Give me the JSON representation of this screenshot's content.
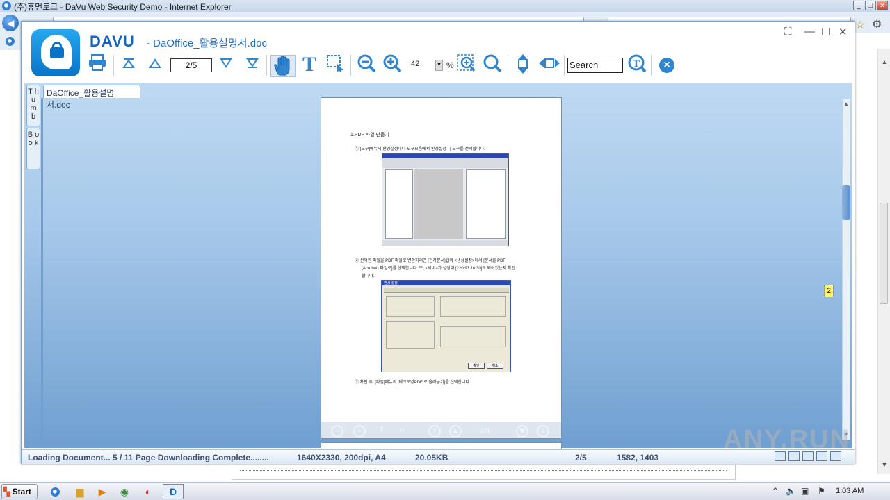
{
  "ie": {
    "title": "(주)휴먼토크 - DaVu Web Security Demo - Internet Explorer",
    "win_min": "_",
    "win_restore": "❐",
    "win_close": "✕"
  },
  "viewer": {
    "brand": "DAVU",
    "doc_title": "- DaOffice_활용설명서.doc",
    "page_input": "2/5",
    "zoom_value": "42",
    "zoom_unit": "%",
    "search_placeholder": "Search",
    "window_controls": [
      "⛶",
      "—",
      "☐",
      "✕"
    ],
    "tab_doc": "DaOffice_활용설명서.doc",
    "side_tabs": [
      "T h u m b",
      "B o o k"
    ],
    "page_badge": "2",
    "icons": [
      "print-icon",
      "first-page-icon",
      "prev-page-icon",
      "next-page-icon",
      "last-page-icon",
      "hand-tool-icon",
      "text-tool-icon",
      "select-tool-icon",
      "zoom-out-icon",
      "zoom-in-icon",
      "zoom-fit-icon",
      "search-zoom-icon",
      "fit-height-icon",
      "fit-width-icon",
      "search-text-icon",
      "close-icon"
    ],
    "page_toolbar_page": "2/5"
  },
  "document": {
    "heading": "1.PDF 파일 만들기",
    "step1": "① [도구]메뉴의 환경설정이나 도구모음에서 환경설정 [  ] 도구를 선택합니다.",
    "step2a": "② 선택한 파일을 PDF 파일로 변환하려면 [전자문서]탭의 <생성설정>에서 [문서를 PDF",
    "step2b": "(Acrobat) 파일로]를 선택합니다. 또, <서버>가 설정이 [220.93.10.30]로 되어있는지 확인",
    "step2c": "합니다.",
    "step3": "③ 확인 후, [파일]메뉴의 [메크로병PDF]로 올려놓기]를 선택합니다.",
    "dialog_title": "환경 설정",
    "dialog_ok": "확인",
    "dialog_cancel": "취소"
  },
  "status": {
    "loading": "Loading Document... 5 / 11 Page Downloading Complete........",
    "resolution": "1640X2330, 200dpi, A4",
    "size": "20.05KB",
    "page": "2/5",
    "coords": "1582, 1403"
  },
  "watermark": "ANY.RUN",
  "taskbar": {
    "start": "Start",
    "clock": "1:03 AM"
  }
}
